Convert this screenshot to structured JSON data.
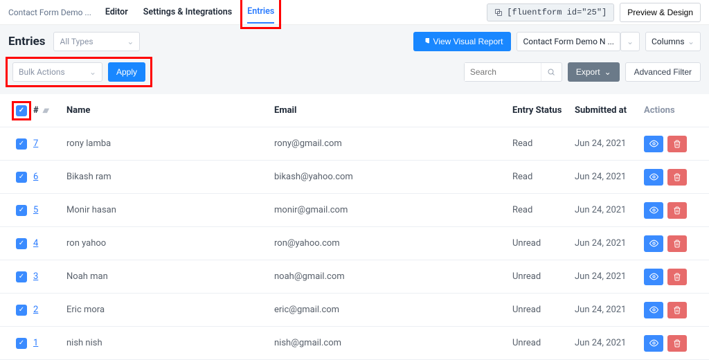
{
  "nav": {
    "crumb": "Contact Form Demo ...",
    "links": {
      "editor": "Editor",
      "settings": "Settings & Integrations",
      "entries": "Entries"
    },
    "shortcode": "[fluentform id=\"25\"]",
    "preview": "Preview & Design"
  },
  "sub": {
    "title": "Entries",
    "type_select": "All Types",
    "view_report": "View Visual Report",
    "form_select": "Contact Form Demo N ...",
    "columns": "Columns"
  },
  "bulk": {
    "placeholder": "Bulk Actions",
    "apply": "Apply",
    "search_placeholder": "Search",
    "export": "Export",
    "advfilter": "Advanced Filter"
  },
  "headers": {
    "idx": "#",
    "name": "Name",
    "email": "Email",
    "status": "Entry Status",
    "submitted": "Submitted at",
    "actions": "Actions"
  },
  "rows": [
    {
      "idx": "7",
      "name": "rony lamba",
      "email": "rony@gmail.com",
      "status": "Read",
      "submitted": "Jun 24, 2021"
    },
    {
      "idx": "6",
      "name": "Bikash ram",
      "email": "bikash@yahoo.com",
      "status": "Read",
      "submitted": "Jun 24, 2021"
    },
    {
      "idx": "5",
      "name": "Monir hasan",
      "email": "monir@gmail.com",
      "status": "Read",
      "submitted": "Jun 24, 2021"
    },
    {
      "idx": "4",
      "name": "ron yahoo",
      "email": "ron@yahoo.com",
      "status": "Unread",
      "submitted": "Jun 24, 2021"
    },
    {
      "idx": "3",
      "name": "Noah man",
      "email": "noah@gmail.com",
      "status": "Unread",
      "submitted": "Jun 24, 2021"
    },
    {
      "idx": "2",
      "name": "Eric mora",
      "email": "eric@gmail.com",
      "status": "Unread",
      "submitted": "Jun 24, 2021"
    },
    {
      "idx": "1",
      "name": "nish nish",
      "email": "nish@gmail.com",
      "status": "Unread",
      "submitted": "Jun 24, 2021"
    }
  ]
}
